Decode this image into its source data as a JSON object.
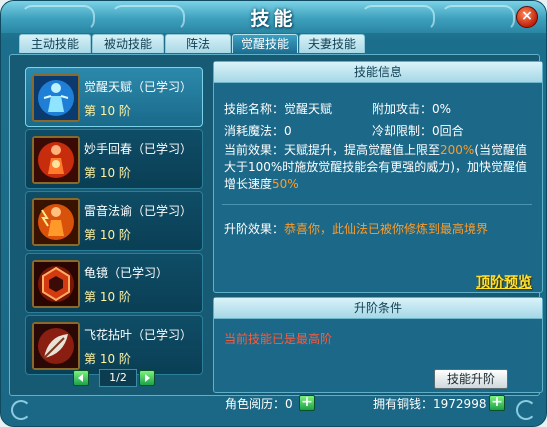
{
  "window": {
    "title": "技能",
    "close_symbol": "×"
  },
  "tabs": [
    {
      "label": "主动技能",
      "active": false
    },
    {
      "label": "被动技能",
      "active": false
    },
    {
      "label": "阵法",
      "active": false
    },
    {
      "label": "觉醒技能",
      "active": true
    },
    {
      "label": "夫妻技能",
      "active": false
    }
  ],
  "skills": [
    {
      "name": "觉醒天赋（已学习）",
      "level": "第 10 阶",
      "icon": "awakening-figure-icon",
      "selected": true
    },
    {
      "name": "妙手回春（已学习）",
      "level": "第 10 阶",
      "icon": "healing-figure-icon",
      "selected": false
    },
    {
      "name": "雷音法谕（已学习）",
      "level": "第 10 阶",
      "icon": "thunder-figure-icon",
      "selected": false
    },
    {
      "name": "龟镜（已学习）",
      "level": "第 10 阶",
      "icon": "turtle-mirror-icon",
      "selected": false
    },
    {
      "name": "飞花拈叶（已学习）",
      "level": "第 10 阶",
      "icon": "flying-leaf-icon",
      "selected": false
    }
  ],
  "pager": {
    "text": "1/2"
  },
  "info": {
    "header": "技能信息",
    "name_label": "技能名称：",
    "name_value": "觉醒天赋",
    "extra_attack_label": "附加攻击：",
    "extra_attack_value": "0%",
    "mana_label": "消耗魔法：",
    "mana_value": "0",
    "cooldown_label": "冷却限制：",
    "cooldown_value": "0回合",
    "effect_label": "当前效果：",
    "effect_text_a": "天赋提升，提高觉醒值上限至",
    "effect_text_b": "200%",
    "effect_text_c": "(当觉醒值大于100%时施放觉醒技能会有更强的威力)，加快觉醒值增长速度",
    "effect_text_d": "50%",
    "upgrade_effect_label": "升阶效果：",
    "upgrade_effect_value": "恭喜你，此仙法已被你修炼到最高境界",
    "preview_link": "顶阶预览"
  },
  "requirements": {
    "header": "升阶条件",
    "text": "当前技能已是最高阶",
    "upgrade_button": "技能升阶"
  },
  "status": {
    "experience_label": "角色阅历：",
    "experience_value": "0",
    "money_label": "拥有铜钱：",
    "money_value": "1972998"
  },
  "colors": {
    "accent": "#1c6888",
    "highlight": "#ff9c28",
    "gold": "#ffe12b"
  }
}
